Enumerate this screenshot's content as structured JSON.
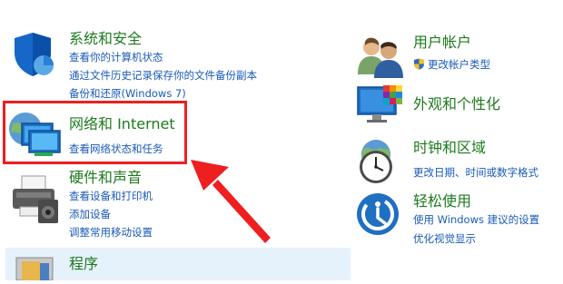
{
  "left": {
    "system_security": {
      "title": "系统和安全",
      "links": [
        "查看你的计算机状态",
        "通过文件历史记录保存你的文件备份副本",
        "备份和还原(Windows 7)"
      ]
    },
    "network": {
      "title": "网络和 Internet",
      "links": [
        "查看网络状态和任务"
      ]
    },
    "hardware": {
      "title": "硬件和声音",
      "links": [
        "查看设备和打印机",
        "添加设备",
        "调整常用移动设置"
      ]
    },
    "programs": {
      "title": "程序"
    }
  },
  "right": {
    "accounts": {
      "title": "用户帐户",
      "links": [
        "更改帐户类型"
      ]
    },
    "appearance": {
      "title": "外观和个性化"
    },
    "clock": {
      "title": "时钟和区域",
      "links": [
        "更改日期、时间或数字格式"
      ]
    },
    "ease": {
      "title": "轻松使用",
      "links": [
        "使用 Windows 建议的设置",
        "优化视觉显示"
      ]
    }
  },
  "colors": {
    "title_green": "#1e7a1e",
    "link_blue": "#1a5ab8",
    "highlight_red": "#ef1f1f"
  }
}
